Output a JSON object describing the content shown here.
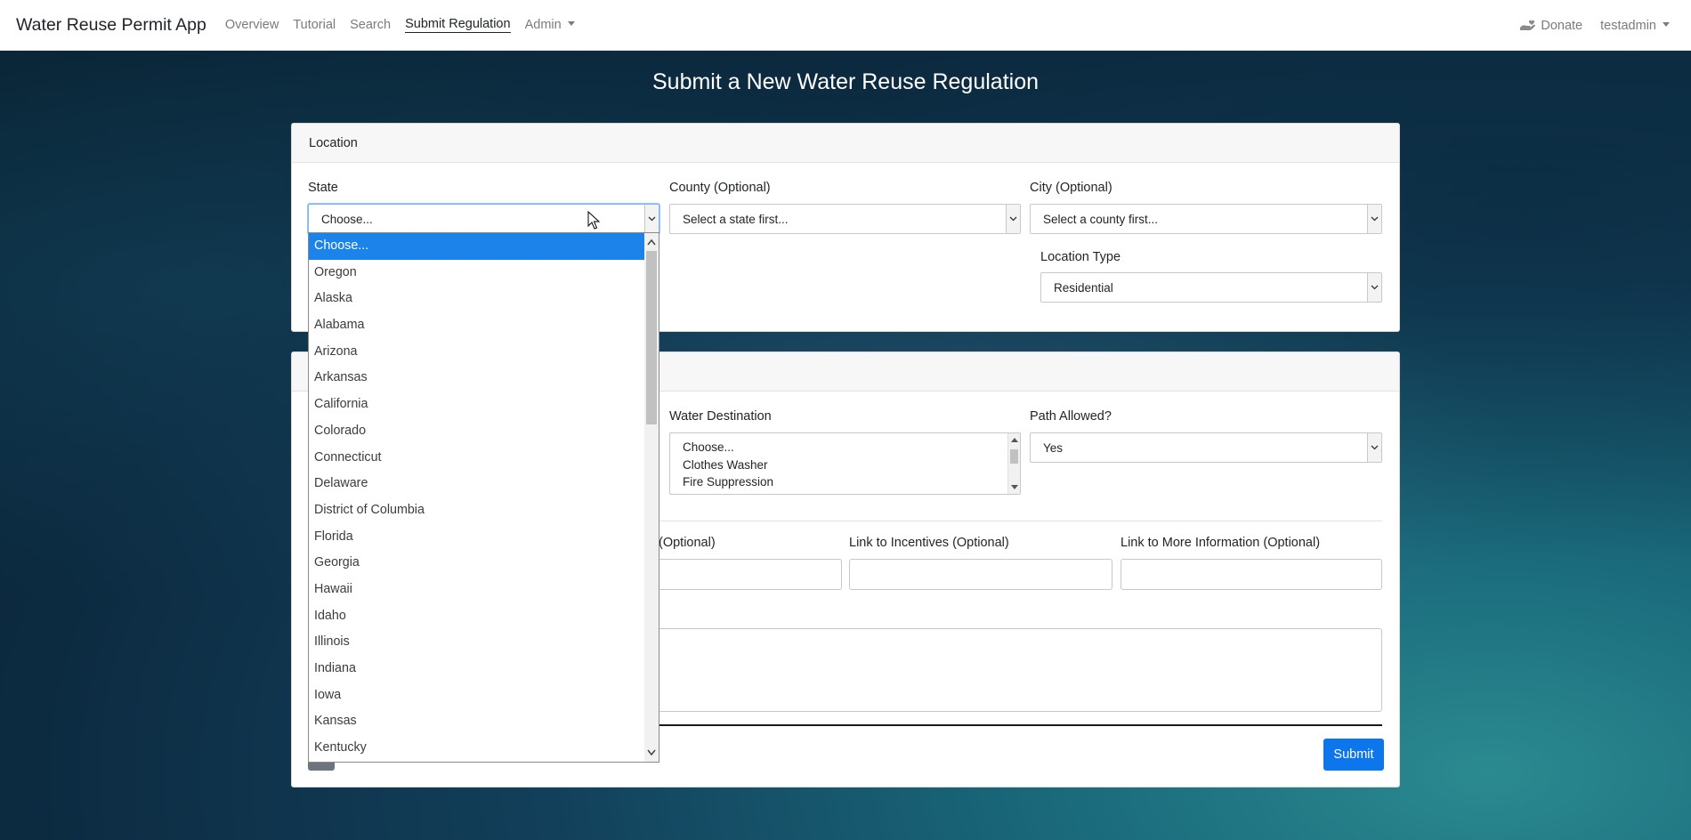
{
  "navbar": {
    "brand": "Water Reuse Permit App",
    "links": [
      {
        "label": "Overview"
      },
      {
        "label": "Tutorial"
      },
      {
        "label": "Search"
      },
      {
        "label": "Submit Regulation"
      }
    ],
    "admin_label": "Admin",
    "donate_label": "Donate",
    "user_label": "testadmin"
  },
  "page": {
    "title": "Submit a New Water Reuse Regulation"
  },
  "location_card": {
    "header": "Location",
    "state_label": "State",
    "state_value": "Choose...",
    "county_label": "County (Optional)",
    "county_value": "Select a state first...",
    "city_label": "City (Optional)",
    "city_value": "Select a county first...",
    "location_type_label": "Location Type",
    "location_type_value": "Residential"
  },
  "details_card": {
    "water_destination_label": "Water Destination",
    "water_destination_options": [
      "Choose...",
      "Clothes Washer",
      "Fire Suppression"
    ],
    "path_allowed_label": "Path Allowed?",
    "path_allowed_value": "Yes",
    "partial_optional_label": "(Optional)",
    "incentives_label": "Link to Incentives (Optional)",
    "more_info_label": "Link to More Information (Optional)",
    "submit_label": "Submit"
  },
  "state_dropdown": {
    "options": [
      "Choose...",
      "Oregon",
      "Alaska",
      "Alabama",
      "Arizona",
      "Arkansas",
      "California",
      "Colorado",
      "Connecticut",
      "Delaware",
      "District of Columbia",
      "Florida",
      "Georgia",
      "Hawaii",
      "Idaho",
      "Illinois",
      "Indiana",
      "Iowa",
      "Kansas",
      "Kentucky"
    ],
    "selected_index": 0
  },
  "colors": {
    "accent": "#1c83ea",
    "submit_button": "#0d76ec"
  }
}
